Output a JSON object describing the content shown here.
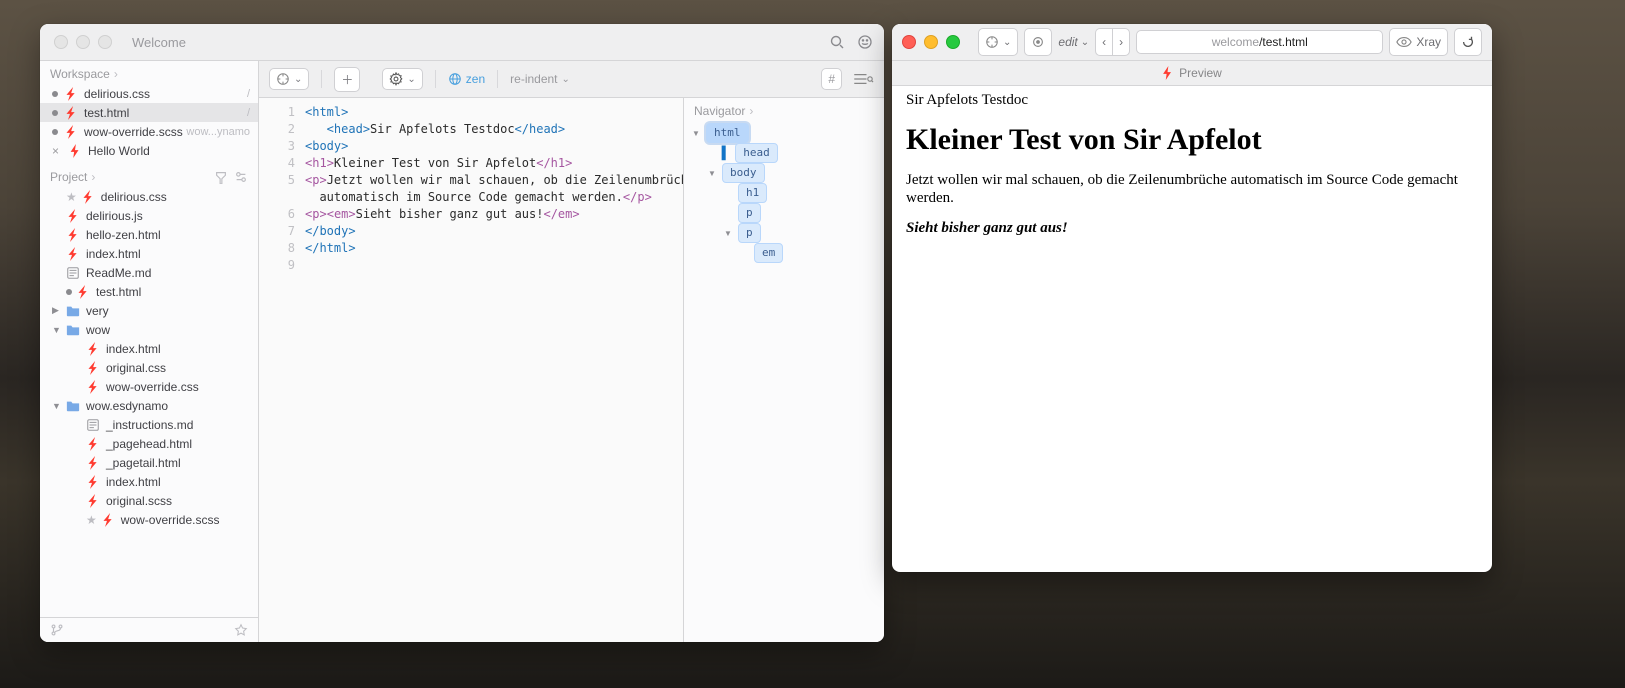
{
  "editor": {
    "title": "Welcome",
    "toolbar": {
      "zen": "zen",
      "reindent": "re-indent"
    },
    "sidebar": {
      "workspace_label": "Workspace",
      "project_label": "Project",
      "workspace": [
        {
          "name": "delirious.css",
          "ico": "css",
          "dot": true,
          "hint": "/"
        },
        {
          "name": "test.html",
          "ico": "html",
          "dot": true,
          "hint": "/",
          "sel": true
        },
        {
          "name": "wow-override.scss",
          "ico": "css",
          "dot": true,
          "hint": "wow...ynamo"
        },
        {
          "name": "Hello World",
          "ico": "lightning",
          "dot": false,
          "close": true
        }
      ],
      "project": [
        {
          "name": "delirious.css",
          "ico": "css",
          "indent": 0,
          "star": true
        },
        {
          "name": "delirious.js",
          "ico": "js",
          "indent": 0
        },
        {
          "name": "hello-zen.html",
          "ico": "html",
          "indent": 0
        },
        {
          "name": "index.html",
          "ico": "html",
          "indent": 0
        },
        {
          "name": "ReadMe.md",
          "ico": "md",
          "indent": 0
        },
        {
          "name": "test.html",
          "ico": "html",
          "indent": 0,
          "dot": true
        },
        {
          "name": "very",
          "ico": "folder",
          "indent": 0,
          "tri": "▶"
        },
        {
          "name": "wow",
          "ico": "folder",
          "indent": 0,
          "tri": "▼"
        },
        {
          "name": "index.html",
          "ico": "html",
          "indent": 1
        },
        {
          "name": "original.css",
          "ico": "css",
          "indent": 1
        },
        {
          "name": "wow-override.css",
          "ico": "css",
          "indent": 1
        },
        {
          "name": "wow.esdynamo",
          "ico": "folder",
          "indent": 0,
          "tri": "▼"
        },
        {
          "name": "_instructions.md",
          "ico": "md",
          "indent": 1
        },
        {
          "name": "_pagehead.html",
          "ico": "html",
          "indent": 1
        },
        {
          "name": "_pagetail.html",
          "ico": "html",
          "indent": 1
        },
        {
          "name": "index.html",
          "ico": "html",
          "indent": 1
        },
        {
          "name": "original.scss",
          "ico": "css",
          "indent": 1
        },
        {
          "name": "wow-override.scss",
          "ico": "css",
          "indent": 1,
          "star": true
        }
      ]
    },
    "navigator": {
      "label": "Navigator",
      "tree": [
        {
          "tag": "html",
          "depth": 0,
          "tri": "▼",
          "sel": true
        },
        {
          "tag": "head",
          "depth": 1,
          "cursor": true
        },
        {
          "tag": "body",
          "depth": 1,
          "tri": "▼"
        },
        {
          "tag": "h1",
          "depth": 2
        },
        {
          "tag": "p",
          "depth": 2
        },
        {
          "tag": "p",
          "depth": 2,
          "tri": "▼"
        },
        {
          "tag": "em",
          "depth": 3
        }
      ]
    },
    "code": {
      "lines": [
        {
          "n": "1",
          "segs": [
            {
              "t": "<",
              "c": "tag"
            },
            {
              "t": "html",
              "c": "tag"
            },
            {
              "t": ">",
              "c": "tag"
            }
          ]
        },
        {
          "n": "2",
          "segs": [
            {
              "t": "   <",
              "c": "tag"
            },
            {
              "t": "head",
              "c": "tag"
            },
            {
              "t": ">",
              "c": "tag"
            },
            {
              "t": "Sir Apfelots Testdoc",
              "c": "txt"
            },
            {
              "t": "</",
              "c": "tag"
            },
            {
              "t": "head",
              "c": "tag"
            },
            {
              "t": ">",
              "c": "tag"
            }
          ]
        },
        {
          "n": "3",
          "segs": [
            {
              "t": "<",
              "c": "tag"
            },
            {
              "t": "body",
              "c": "tag"
            },
            {
              "t": ">",
              "c": "tag"
            }
          ]
        },
        {
          "n": "4",
          "segs": [
            {
              "t": "<",
              "c": "tag2"
            },
            {
              "t": "h1",
              "c": "tag2"
            },
            {
              "t": ">",
              "c": "tag2"
            },
            {
              "t": "Kleiner Test von Sir Apfelot",
              "c": "txt"
            },
            {
              "t": "</",
              "c": "tag2"
            },
            {
              "t": "h1",
              "c": "tag2"
            },
            {
              "t": ">",
              "c": "tag2"
            }
          ]
        },
        {
          "n": "5",
          "segs": [
            {
              "t": "<",
              "c": "tag2"
            },
            {
              "t": "p",
              "c": "tag2"
            },
            {
              "t": ">",
              "c": "tag2"
            },
            {
              "t": "Jetzt wollen wir mal schauen, ob die Zeilenumbrüche",
              "c": "txt"
            }
          ]
        },
        {
          "n": "",
          "segs": [
            {
              "t": "  automatisch im Source Code gemacht werden.",
              "c": "txt"
            },
            {
              "t": "</",
              "c": "tag2"
            },
            {
              "t": "p",
              "c": "tag2"
            },
            {
              "t": ">",
              "c": "tag2"
            }
          ]
        },
        {
          "n": "6",
          "segs": [
            {
              "t": "<",
              "c": "tag2"
            },
            {
              "t": "p",
              "c": "tag2"
            },
            {
              "t": ">",
              "c": "tag2"
            },
            {
              "t": "<",
              "c": "tag2"
            },
            {
              "t": "em",
              "c": "tag2"
            },
            {
              "t": ">",
              "c": "tag2"
            },
            {
              "t": "Sieht bisher ganz gut aus!",
              "c": "txt"
            },
            {
              "t": "</",
              "c": "tag2"
            },
            {
              "t": "em",
              "c": "tag2"
            },
            {
              "t": ">",
              "c": "tag2"
            }
          ]
        },
        {
          "n": "7",
          "segs": [
            {
              "t": "</",
              "c": "tag"
            },
            {
              "t": "body",
              "c": "tag"
            },
            {
              "t": ">",
              "c": "tag"
            }
          ]
        },
        {
          "n": "8",
          "segs": [
            {
              "t": "</",
              "c": "tag"
            },
            {
              "t": "html",
              "c": "tag"
            },
            {
              "t": ">",
              "c": "tag"
            }
          ]
        },
        {
          "n": "9",
          "segs": []
        }
      ]
    }
  },
  "preview": {
    "edit_label": "edit",
    "url_prefix": "welcome",
    "url_name": "/test.html",
    "xray_label": "Xray",
    "tab_label": "Preview",
    "doc": {
      "title_text": "Sir Apfelots Testdoc",
      "h1": "Kleiner Test von Sir Apfelot",
      "p1": "Jetzt wollen wir mal schauen, ob die Zeilenumbrüche automatisch im Source Code gemacht werden.",
      "p2": "Sieht bisher ganz gut aus!"
    }
  }
}
